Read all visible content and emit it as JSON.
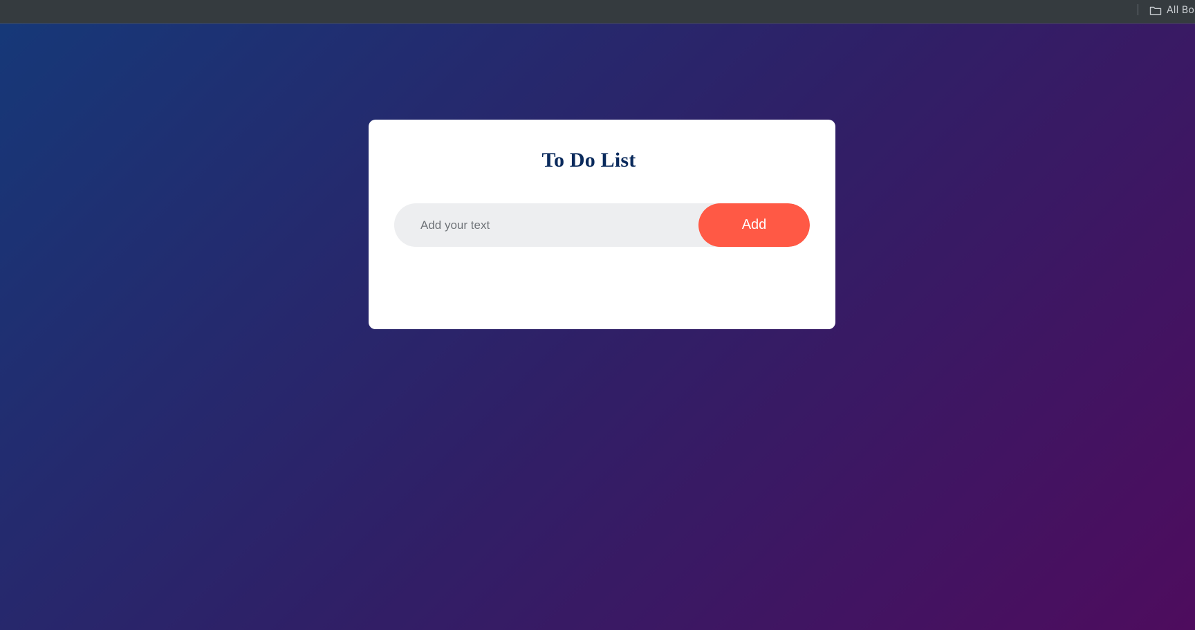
{
  "bookmarks_bar": {
    "all_bookmarks_label": "All Bo",
    "folder_icon": "folder-icon"
  },
  "todo": {
    "title": "To Do List",
    "input_placeholder": "Add your text",
    "input_value": "",
    "add_button_label": "Add"
  },
  "colors": {
    "gradient_start": "#163878",
    "gradient_mid": "#2f2067",
    "gradient_end": "#4e0c5e",
    "title_color": "#0a2a5c",
    "button_color": "#ff5945",
    "input_bg": "#edeef0",
    "bookmarks_bar_bg": "#353b3f"
  }
}
